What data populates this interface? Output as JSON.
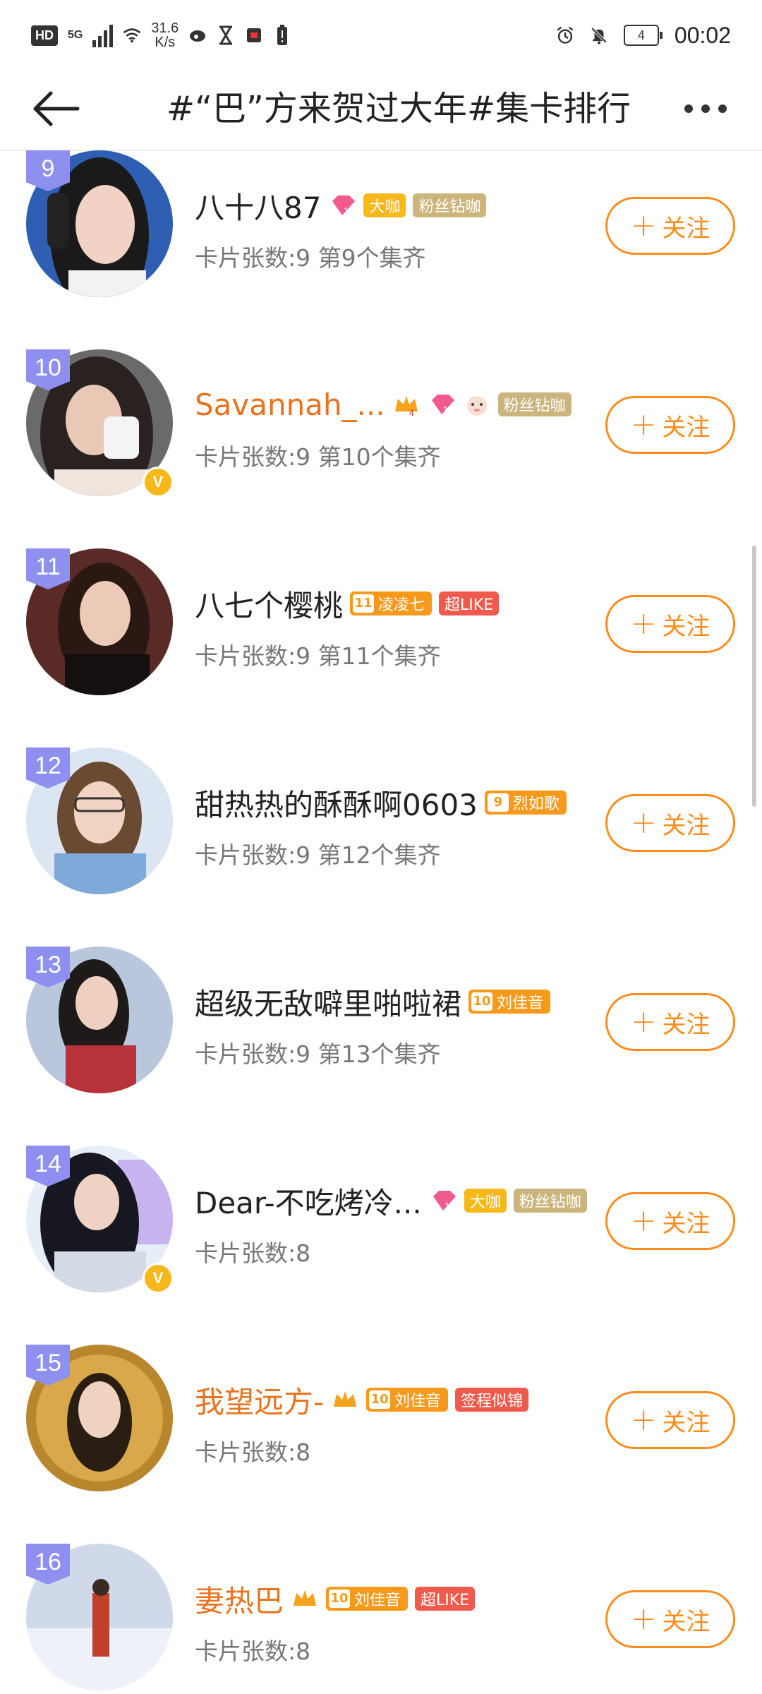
{
  "status_bar": {
    "hd": "HD",
    "net": "5G",
    "speed_value": "31.6",
    "speed_unit": "K/s",
    "battery": "4",
    "time": "00:02"
  },
  "header": {
    "title": "#“巴”方来贺过大年#集卡排行"
  },
  "follow_label": "关注",
  "rows": [
    {
      "rank": "9",
      "name": "八十八87",
      "meta": "卡片张数:9  第9个集齐",
      "badges": [
        "大咖",
        "粉丝钻咖"
      ],
      "gem_level": "12"
    },
    {
      "rank": "10",
      "name": "Savannah_...",
      "meta": "卡片张数:9  第10个集齐",
      "badges": [
        "粉丝钻咖"
      ],
      "gem_level": "12",
      "crown_level": "4"
    },
    {
      "rank": "11",
      "name": "八七个樱桃",
      "meta": "卡片张数:9  第11个集齐",
      "lvl": {
        "num": "11",
        "text": "凌凌七"
      },
      "badges": [
        "超LIKE"
      ]
    },
    {
      "rank": "12",
      "name": "甜热热的酥酥啊0603",
      "meta": "卡片张数:9  第12个集齐",
      "lvl": {
        "num": "9",
        "text": "烈如歌"
      }
    },
    {
      "rank": "13",
      "name": "超级无敌噼里啪啦裙",
      "meta": "卡片张数:9  第13个集齐",
      "lvl": {
        "num": "10",
        "text": "刘佳音"
      }
    },
    {
      "rank": "14",
      "name": "Dear-不吃烤冷...",
      "meta": "卡片张数:8",
      "badges": [
        "大咖",
        "粉丝钻咖"
      ],
      "gem_level": "13"
    },
    {
      "rank": "15",
      "name": "我望远方-",
      "meta": "卡片张数:8",
      "lvl": {
        "num": "10",
        "text": "刘佳音"
      },
      "badges": [
        "签程似锦"
      ]
    },
    {
      "rank": "16",
      "name": "妻热巴",
      "meta": "卡片张数:8",
      "lvl": {
        "num": "10",
        "text": "刘佳音"
      },
      "badges": [
        "超LIKE"
      ]
    }
  ],
  "icons": {
    "back": "arrow-left-icon",
    "more": "more-dots-icon",
    "alarm": "alarm-icon",
    "mute": "bell-off-icon",
    "verified": "verified-v-icon"
  },
  "colors": {
    "accent": "#ff8c1a",
    "rank_badge": "#8f8ff0",
    "orange_name": "#e8731e"
  }
}
